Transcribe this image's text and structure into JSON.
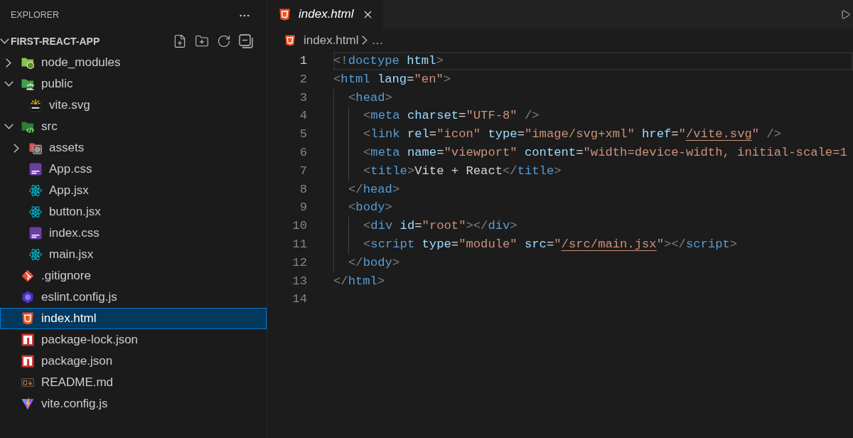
{
  "sidebar": {
    "title": "EXPLORER",
    "root": {
      "label": "FIRST-REACT-APP",
      "expanded": true,
      "children": [
        {
          "label": "node_modules",
          "kind": "modules",
          "expanded": false,
          "selected": false
        },
        {
          "label": "public",
          "kind": "public",
          "expanded": true,
          "selected": false,
          "children": [
            {
              "label": "vite.svg",
              "kind": "svg",
              "selected": false
            }
          ]
        },
        {
          "label": "src",
          "kind": "source",
          "expanded": true,
          "selected": false,
          "children": [
            {
              "label": "assets",
              "kind": "assets",
              "expanded": false,
              "selected": false
            },
            {
              "label": "App.css",
              "kind": "css",
              "selected": false
            },
            {
              "label": "App.jsx",
              "kind": "react",
              "selected": false
            },
            {
              "label": "button.jsx",
              "kind": "react",
              "selected": false
            },
            {
              "label": "index.css",
              "kind": "css",
              "selected": false
            },
            {
              "label": "main.jsx",
              "kind": "react",
              "selected": false
            }
          ]
        },
        {
          "label": ".gitignore",
          "kind": "git",
          "selected": false
        },
        {
          "label": "eslint.config.js",
          "kind": "eslint",
          "selected": false
        },
        {
          "label": "index.html",
          "kind": "html",
          "selected": true
        },
        {
          "label": "package-lock.json",
          "kind": "npm",
          "selected": false
        },
        {
          "label": "package.json",
          "kind": "npm",
          "selected": false
        },
        {
          "label": "README.md",
          "kind": "markdown",
          "selected": false
        },
        {
          "label": "vite.config.js",
          "kind": "vite",
          "selected": false
        }
      ]
    }
  },
  "editor": {
    "tabs": [
      {
        "label": "index.html",
        "kind": "html",
        "selected": true,
        "preview": true
      }
    ],
    "breadcrumb": [
      {
        "label": "index.html",
        "kind": "html"
      },
      {
        "label": "…",
        "kind": "more"
      }
    ],
    "lines": [
      {
        "number": "1",
        "current": true,
        "tokens": [
          {
            "kind": "bracket",
            "text": "<!"
          },
          {
            "kind": "tag",
            "text": "doctype"
          },
          {
            "kind": "attr",
            "text": " html"
          },
          {
            "kind": "bracket",
            "text": ">"
          }
        ]
      },
      {
        "number": "2",
        "current": false,
        "tokens": [
          {
            "kind": "bracket",
            "text": "<"
          },
          {
            "kind": "tag",
            "text": "html"
          },
          {
            "kind": "attr",
            "text": " lang"
          },
          {
            "kind": "eq",
            "text": "="
          },
          {
            "kind": "string",
            "text": "\"en\""
          },
          {
            "kind": "bracket",
            "text": ">"
          }
        ],
        "children": [
          {
            "number": "3",
            "current": false,
            "tokens": [
              {
                "kind": "bracket",
                "text": "<"
              },
              {
                "kind": "tag",
                "text": "head"
              },
              {
                "kind": "bracket",
                "text": ">"
              }
            ],
            "children": [
              {
                "number": "4",
                "current": false,
                "tokens": [
                  {
                    "kind": "bracket",
                    "text": "<"
                  },
                  {
                    "kind": "tag",
                    "text": "meta"
                  },
                  {
                    "kind": "attr",
                    "text": " charset"
                  },
                  {
                    "kind": "eq",
                    "text": "="
                  },
                  {
                    "kind": "string",
                    "text": "\"UTF-8\""
                  },
                  {
                    "kind": "bracket",
                    "text": " />"
                  }
                ]
              },
              {
                "number": "5",
                "current": false,
                "tokens": [
                  {
                    "kind": "bracket",
                    "text": "<"
                  },
                  {
                    "kind": "tag",
                    "text": "link"
                  },
                  {
                    "kind": "attr",
                    "text": " rel"
                  },
                  {
                    "kind": "eq",
                    "text": "="
                  },
                  {
                    "kind": "string",
                    "text": "\"icon\""
                  },
                  {
                    "kind": "attr",
                    "text": " type"
                  },
                  {
                    "kind": "eq",
                    "text": "="
                  },
                  {
                    "kind": "string",
                    "text": "\"image/svg+xml\""
                  },
                  {
                    "kind": "attr",
                    "text": " href"
                  },
                  {
                    "kind": "eq",
                    "text": "="
                  },
                  {
                    "kind": "string",
                    "text": "\""
                  },
                  {
                    "kind": "link",
                    "text": "/vite.svg"
                  },
                  {
                    "kind": "string",
                    "text": "\""
                  },
                  {
                    "kind": "bracket",
                    "text": " />"
                  }
                ]
              },
              {
                "number": "6",
                "current": false,
                "tokens": [
                  {
                    "kind": "bracket",
                    "text": "<"
                  },
                  {
                    "kind": "tag",
                    "text": "meta"
                  },
                  {
                    "kind": "attr",
                    "text": " name"
                  },
                  {
                    "kind": "eq",
                    "text": "="
                  },
                  {
                    "kind": "string",
                    "text": "\"viewport\""
                  },
                  {
                    "kind": "attr",
                    "text": " content"
                  },
                  {
                    "kind": "eq",
                    "text": "="
                  },
                  {
                    "kind": "string",
                    "text": "\"width=device-width, initial-scale=1"
                  }
                ]
              },
              {
                "number": "7",
                "current": false,
                "tokens": [
                  {
                    "kind": "bracket",
                    "text": "<"
                  },
                  {
                    "kind": "tag",
                    "text": "title"
                  },
                  {
                    "kind": "bracket",
                    "text": ">"
                  },
                  {
                    "kind": "text",
                    "text": "Vite + React"
                  },
                  {
                    "kind": "bracket",
                    "text": "</"
                  },
                  {
                    "kind": "tag",
                    "text": "title"
                  },
                  {
                    "kind": "bracket",
                    "text": ">"
                  }
                ]
              }
            ]
          },
          {
            "number": "8",
            "current": false,
            "tokens": [
              {
                "kind": "bracket",
                "text": "</"
              },
              {
                "kind": "tag",
                "text": "head"
              },
              {
                "kind": "bracket",
                "text": ">"
              }
            ]
          },
          {
            "number": "9",
            "current": false,
            "tokens": [
              {
                "kind": "bracket",
                "text": "<"
              },
              {
                "kind": "tag",
                "text": "body"
              },
              {
                "kind": "bracket",
                "text": ">"
              }
            ],
            "children": [
              {
                "number": "10",
                "current": false,
                "tokens": [
                  {
                    "kind": "bracket",
                    "text": "<"
                  },
                  {
                    "kind": "tag",
                    "text": "div"
                  },
                  {
                    "kind": "attr",
                    "text": " id"
                  },
                  {
                    "kind": "eq",
                    "text": "="
                  },
                  {
                    "kind": "string",
                    "text": "\"root\""
                  },
                  {
                    "kind": "bracket",
                    "text": "></"
                  },
                  {
                    "kind": "tag",
                    "text": "div"
                  },
                  {
                    "kind": "bracket",
                    "text": ">"
                  }
                ]
              },
              {
                "number": "11",
                "current": false,
                "tokens": [
                  {
                    "kind": "bracket",
                    "text": "<"
                  },
                  {
                    "kind": "tag",
                    "text": "script"
                  },
                  {
                    "kind": "attr",
                    "text": " type"
                  },
                  {
                    "kind": "eq",
                    "text": "="
                  },
                  {
                    "kind": "string",
                    "text": "\"module\""
                  },
                  {
                    "kind": "attr",
                    "text": " src"
                  },
                  {
                    "kind": "eq",
                    "text": "="
                  },
                  {
                    "kind": "string",
                    "text": "\""
                  },
                  {
                    "kind": "link",
                    "text": "/src/main.jsx"
                  },
                  {
                    "kind": "string",
                    "text": "\""
                  },
                  {
                    "kind": "bracket",
                    "text": "></"
                  },
                  {
                    "kind": "tag",
                    "text": "script"
                  },
                  {
                    "kind": "bracket",
                    "text": ">"
                  }
                ]
              }
            ]
          },
          {
            "number": "12",
            "current": false,
            "tokens": [
              {
                "kind": "bracket",
                "text": "</"
              },
              {
                "kind": "tag",
                "text": "body"
              },
              {
                "kind": "bracket",
                "text": ">"
              }
            ]
          }
        ]
      },
      {
        "number": "13",
        "current": false,
        "tokens": [
          {
            "kind": "bracket",
            "text": "</"
          },
          {
            "kind": "tag",
            "text": "html"
          },
          {
            "kind": "bracket",
            "text": ">"
          }
        ]
      },
      {
        "number": "14",
        "current": false
      }
    ]
  }
}
